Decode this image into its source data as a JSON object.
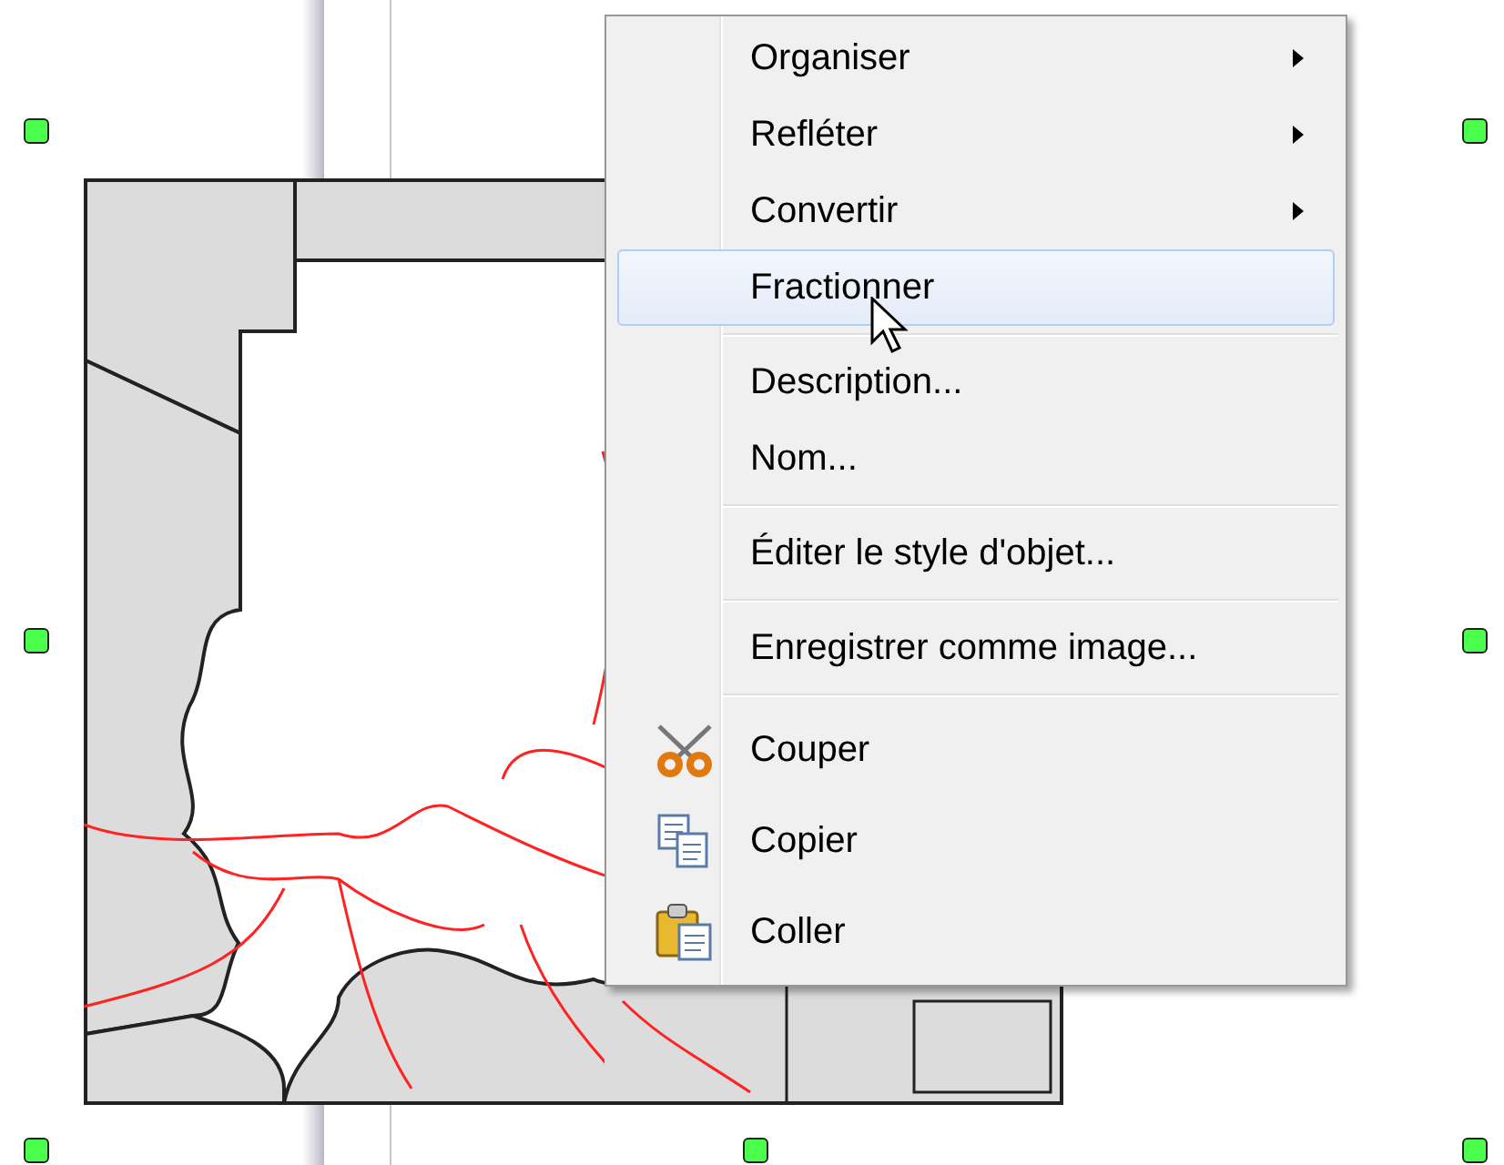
{
  "context_menu": {
    "groups": [
      [
        {
          "label": "Organiser",
          "kind": "plain",
          "submenu": true,
          "selected": false
        },
        {
          "label": "Refléter",
          "kind": "plain",
          "submenu": true,
          "selected": false
        },
        {
          "label": "Convertir",
          "kind": "plain",
          "submenu": true,
          "selected": false
        },
        {
          "label": "Fractionner",
          "kind": "plain",
          "submenu": false,
          "selected": true
        }
      ],
      [
        {
          "label": "Description...",
          "kind": "plain",
          "submenu": false,
          "selected": false
        },
        {
          "label": "Nom...",
          "kind": "plain",
          "submenu": false,
          "selected": false
        }
      ],
      [
        {
          "label": "Éditer le style d'objet...",
          "kind": "plain",
          "submenu": false,
          "selected": false
        }
      ],
      [
        {
          "label": "Enregistrer comme image...",
          "kind": "plain",
          "submenu": false,
          "selected": false
        }
      ],
      [
        {
          "label": "Couper",
          "kind": "cut",
          "submenu": false,
          "selected": false
        },
        {
          "label": "Copier",
          "kind": "copy",
          "submenu": false,
          "selected": false
        },
        {
          "label": "Coller",
          "kind": "paste",
          "submenu": false,
          "selected": false
        }
      ]
    ]
  }
}
